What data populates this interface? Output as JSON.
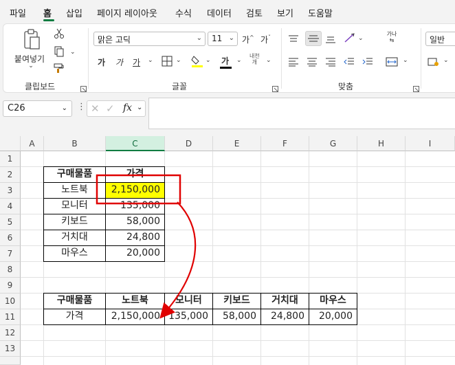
{
  "menu": [
    "파일",
    "홈",
    "삽입",
    "페이지 레이아웃",
    "수식",
    "데이터",
    "검토",
    "보기",
    "도움말"
  ],
  "ribbon": {
    "clipboard": {
      "paste_label": "붙여넣기",
      "group_label": "클립보드"
    },
    "font": {
      "font_name": "맑은 고딕",
      "font_size": "11",
      "grow": "가",
      "shrink": "가",
      "bold": "가",
      "italic": "가",
      "underline": "가",
      "color_a": "가",
      "phonetic": "내천",
      "phonetic2": "개",
      "group_label": "글꼴"
    },
    "alignment": {
      "wrap": "가나",
      "group_label": "맞춤"
    },
    "number": {
      "format": "일반"
    }
  },
  "formula_bar": {
    "name_box": "C26",
    "fx": "fx",
    "formula": ""
  },
  "columns": [
    "A",
    "B",
    "C",
    "D",
    "E",
    "F",
    "G",
    "H",
    "I"
  ],
  "rows": [
    "1",
    "2",
    "3",
    "4",
    "5",
    "6",
    "7",
    "8",
    "9",
    "10",
    "11",
    "12",
    "13"
  ],
  "table1": {
    "header": [
      "구매물품",
      "가격"
    ],
    "rows": [
      [
        "노트북",
        "2,150,000"
      ],
      [
        "모니터",
        "135,000"
      ],
      [
        "키보드",
        "58,000"
      ],
      [
        "거치대",
        "24,800"
      ],
      [
        "마우스",
        "20,000"
      ]
    ]
  },
  "table2": {
    "header": [
      "구매물품",
      "노트북",
      "모니터",
      "키보드",
      "거치대",
      "마우스"
    ],
    "row": [
      "가격",
      "2,150,000",
      "135,000",
      "58,000",
      "24,800",
      "20,000"
    ]
  },
  "colors": {
    "accent": "#107c41",
    "highlight": "#ffff00",
    "annotation": "#e00000"
  }
}
